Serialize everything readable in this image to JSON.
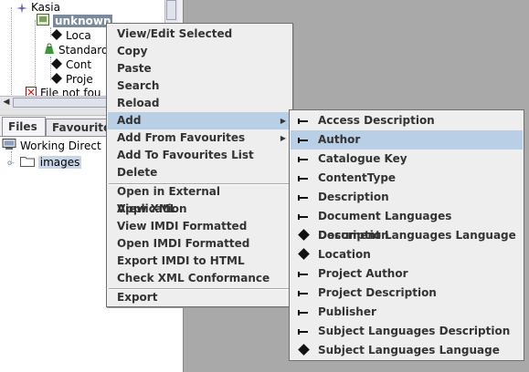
{
  "tree": {
    "items": [
      {
        "label": "Kasia"
      },
      {
        "label": "unknown"
      },
      {
        "label": "Loca"
      },
      {
        "label": "Standard"
      },
      {
        "label": "Cont"
      },
      {
        "label": "Proje"
      },
      {
        "label": "File not fou"
      }
    ]
  },
  "tabs": [
    {
      "label": "Files"
    },
    {
      "label": "Favourites"
    }
  ],
  "files": {
    "items": [
      {
        "label": "Working Direct"
      },
      {
        "label": "images"
      }
    ]
  },
  "context_menu": {
    "groups": [
      [
        "View/Edit Selected",
        "Copy",
        "Paste",
        "Search",
        "Reload",
        "Add",
        "Add From Favourites",
        "Add To Favourites List",
        "Delete"
      ],
      [
        "Open in External Application",
        "View XML",
        "View IMDI Formatted",
        "Open IMDI Formatted",
        "Export IMDI to HTML",
        "Check XML Conformance"
      ],
      [
        "Export"
      ]
    ],
    "hovered": "Add",
    "submenu_items": [
      "Add",
      "Add From Favourites"
    ]
  },
  "add_submenu": {
    "hovered": "Author",
    "items": [
      {
        "label": "Access Description",
        "icon": "dash-icon"
      },
      {
        "label": "Author",
        "icon": "dash-icon"
      },
      {
        "label": "Catalogue Key",
        "icon": "dash-icon"
      },
      {
        "label": "ContentType",
        "icon": "dash-icon"
      },
      {
        "label": "Description",
        "icon": "dash-icon"
      },
      {
        "label": "Document Languages Description",
        "icon": "dash-icon"
      },
      {
        "label": "Document Languages Language",
        "icon": "diamond-icon"
      },
      {
        "label": "Location",
        "icon": "diamond-icon"
      },
      {
        "label": "Project Author",
        "icon": "dash-icon"
      },
      {
        "label": "Project Description",
        "icon": "dash-icon"
      },
      {
        "label": "Publisher",
        "icon": "dash-icon"
      },
      {
        "label": "Subject Languages Description",
        "icon": "dash-icon"
      },
      {
        "label": "Subject Languages Language",
        "icon": "diamond-icon"
      }
    ]
  }
}
